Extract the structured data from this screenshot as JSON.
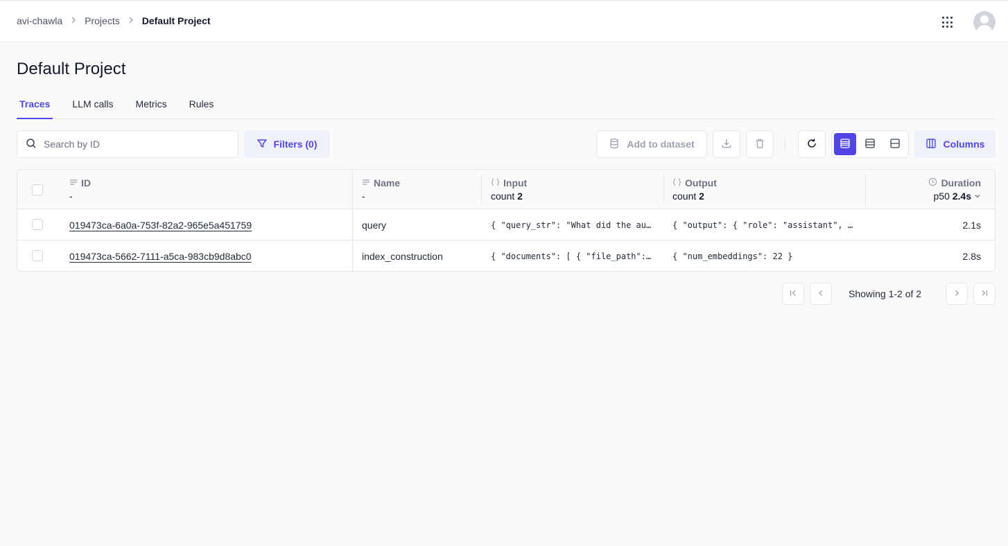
{
  "breadcrumb": {
    "items": [
      "avi-chawla",
      "Projects",
      "Default Project"
    ]
  },
  "header": {
    "apps_icon": "grid-apps-icon",
    "avatar_icon": "user-avatar-icon"
  },
  "page": {
    "title": "Default Project"
  },
  "tabs": [
    {
      "label": "Traces",
      "active": true
    },
    {
      "label": "LLM calls",
      "active": false
    },
    {
      "label": "Metrics",
      "active": false
    },
    {
      "label": "Rules",
      "active": false
    }
  ],
  "toolbar": {
    "search_placeholder": "Search by ID",
    "filters_label": "Filters (0)",
    "add_to_dataset_label": "Add to dataset",
    "columns_label": "Columns",
    "accent_color": "#4f46e5"
  },
  "table": {
    "columns": {
      "id": {
        "label": "ID",
        "stat": "-"
      },
      "name": {
        "label": "Name",
        "stat": "-"
      },
      "input": {
        "label": "Input",
        "stat_prefix": "count",
        "stat_value": "2"
      },
      "output": {
        "label": "Output",
        "stat_prefix": "count",
        "stat_value": "2"
      },
      "duration": {
        "label": "Duration",
        "stat_prefix": "p50",
        "stat_value": "2.4s"
      }
    },
    "rows": [
      {
        "id": "019473ca-6a0a-753f-82a2-965e5a451759",
        "name": "query",
        "input": "{ \"query_str\": \"What did the author do growing up?\" }",
        "output": "{ \"output\": { \"role\": \"assistant\", \"content\": \"...\" } }",
        "duration": "2.1s"
      },
      {
        "id": "019473ca-5662-7111-a5ca-983cb9d8abc0",
        "name": "index_construction",
        "input": "{ \"documents\": [ { \"file_path\": \"...\" } ] }",
        "output": "{ \"num_embeddings\": 22 }",
        "duration": "2.8s"
      }
    ]
  },
  "pagination": {
    "info": "Showing 1-2 of 2"
  }
}
